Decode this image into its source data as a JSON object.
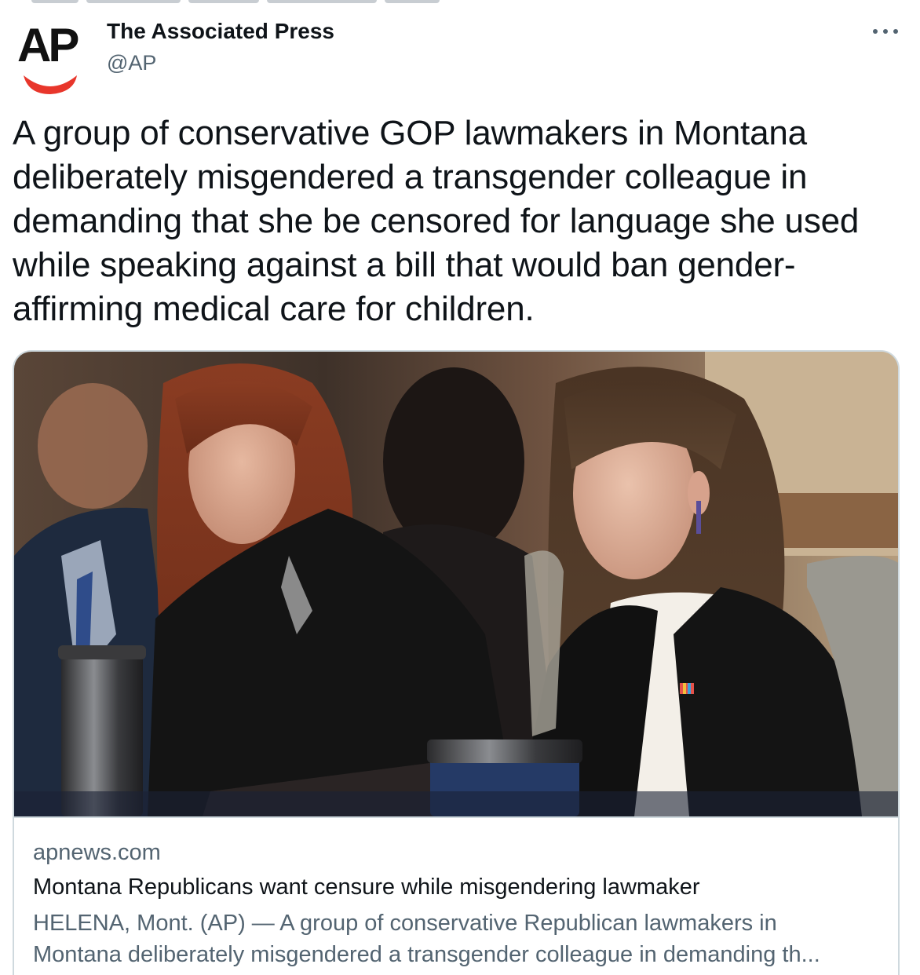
{
  "tweet": {
    "author_name": "The Associated Press",
    "author_handle": "@AP",
    "avatar_text": "AP",
    "text": "A group of conservative GOP lawmakers in Montana deliberately misgendered a transgender colleague in demanding that she be censored for language she used while speaking against a bill that would ban gender-affirming medical care for children.",
    "more_icon": "more-horizontal-icon"
  },
  "card": {
    "domain": "apnews.com",
    "title": "Montana Republicans want censure while misgendering lawmaker",
    "description": "HELENA, Mont. (AP) — A group of conservative Republican lawmakers in Montana deliberately misgendered a transgender colleague in demanding th..."
  },
  "colors": {
    "text_primary": "#0f1419",
    "text_secondary": "#536471",
    "border": "#cfd9de",
    "ap_red": "#e8362b"
  }
}
